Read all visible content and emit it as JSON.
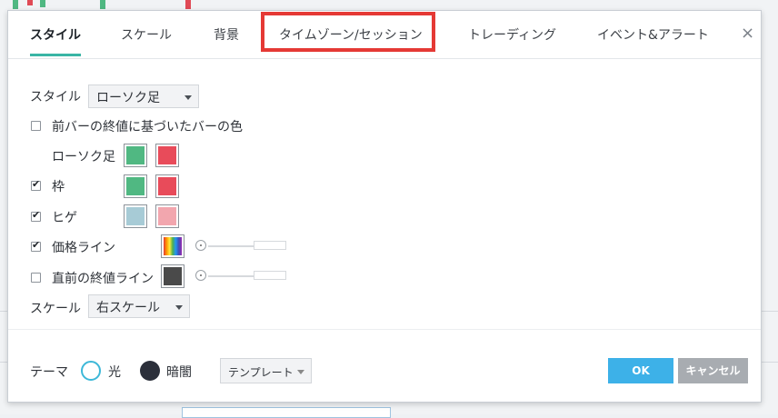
{
  "tabs": [
    {
      "label": "スタイル"
    },
    {
      "label": "スケール"
    },
    {
      "label": "背景"
    },
    {
      "label": "タイムゾーン/セッション"
    },
    {
      "label": "トレーディング"
    },
    {
      "label": "イベント&アラート"
    }
  ],
  "close_symbol": "×",
  "style_row": {
    "label": "スタイル",
    "value": "ローソク足"
  },
  "prev_bar_color": {
    "label": "前バーの終値に基づいたバーの色",
    "checked": false
  },
  "candles": {
    "label": "ローソク足",
    "up_color": "#50b882",
    "down_color": "#e84b5a"
  },
  "border": {
    "label": "枠",
    "checked": true,
    "up_color": "#50b882",
    "down_color": "#e84b5a"
  },
  "wick": {
    "label": "ヒゲ",
    "checked": true,
    "up_color": "#a7cbd6",
    "down_color": "#f2a6ae"
  },
  "price_line": {
    "label": "価格ライン",
    "checked": true
  },
  "prev_close_line": {
    "label": "直前の終値ライン",
    "checked": false,
    "color": "#4a4a4a"
  },
  "scale_row": {
    "label": "スケール",
    "value": "右スケール"
  },
  "theme": {
    "label": "テーマ",
    "light_label": "光",
    "dark_label": "暗闇",
    "template_label": "テンプレート"
  },
  "buttons": {
    "ok": "OK",
    "cancel": "キャンセル"
  },
  "colors": {
    "accent": "#39b5a5",
    "ok": "#3db1e8",
    "cancel": "#a8acb1",
    "highlight": "#e53935"
  }
}
